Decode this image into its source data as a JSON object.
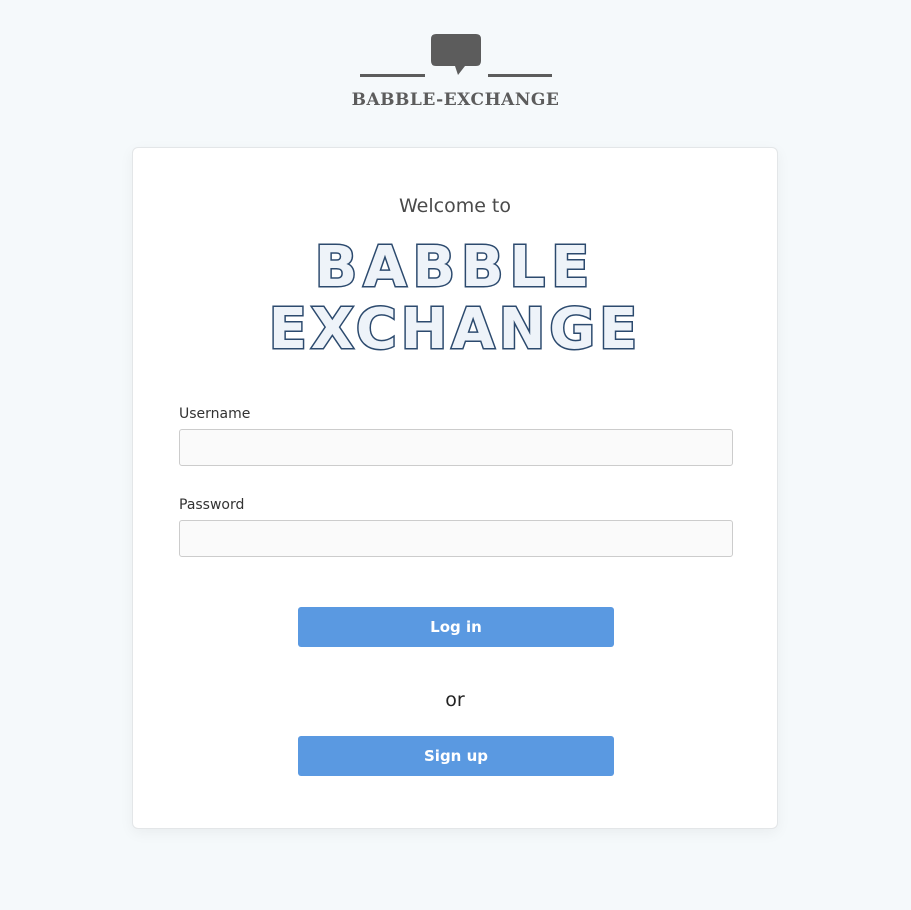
{
  "header": {
    "brand_wordmark": "BABBLE-EXCHANGE"
  },
  "card": {
    "welcome_text": "Welcome to",
    "logo_line1": "BABBLE",
    "logo_line2": "EXCHANGE",
    "username_label": "Username",
    "username_value": "",
    "username_placeholder": "",
    "password_label": "Password",
    "password_value": "",
    "password_placeholder": "",
    "login_label": "Log in",
    "or_text": "or",
    "signup_label": "Sign up"
  },
  "colors": {
    "page_background": "#f5f9fb",
    "card_background": "#ffffff",
    "brand_gray": "#5c5c5c",
    "logo_outline": "#2c4a6e",
    "logo_fill": "#eef3f9",
    "button_blue": "#5a99e1",
    "button_text": "#ffffff"
  },
  "icons": {
    "header_icon": "speech-bubble-icon"
  }
}
